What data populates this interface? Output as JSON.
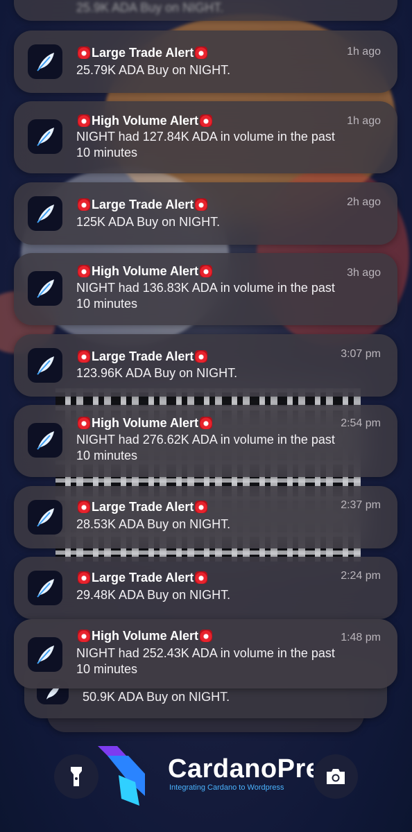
{
  "top_partial": {
    "text": "25.9K ADA Buy on NIGHT."
  },
  "notifications": [
    {
      "title": "Large Trade Alert",
      "time": "1h ago",
      "body": "25.79K ADA Buy on NIGHT."
    },
    {
      "title": "High Volume Alert",
      "time": "1h ago",
      "body": "NIGHT had 127.84K ADA in volume in the past\n10 minutes"
    },
    {
      "title": "Large Trade Alert",
      "time": "2h ago",
      "body": "125K ADA Buy on NIGHT."
    },
    {
      "title": "High Volume Alert",
      "time": "3h ago",
      "body": "NIGHT had 136.83K ADA in volume in the past\n10 minutes"
    },
    {
      "title": "Large Trade Alert",
      "time": "3:07 pm",
      "body": "123.96K ADA Buy on NIGHT."
    },
    {
      "title": "High Volume Alert",
      "time": "2:54 pm",
      "body": "NIGHT had 276.62K ADA in volume in the past\n10 minutes"
    },
    {
      "title": "Large Trade Alert",
      "time": "2:37 pm",
      "body": "28.53K ADA Buy on NIGHT."
    },
    {
      "title": "Large Trade Alert",
      "time": "2:24 pm",
      "body": "29.48K ADA Buy on NIGHT."
    },
    {
      "title": "High Volume Alert",
      "time": "1:48 pm",
      "body": "NIGHT had 252.43K ADA in volume in the past\n10 minutes"
    }
  ],
  "stacked_below": {
    "body": "50.9K ADA Buy on NIGHT."
  },
  "brand": {
    "name": "CardanoPress",
    "tagline": "Integrating Cardano to Wordpress"
  },
  "icons": {
    "app": "feather-icon",
    "alert": "siren-icon",
    "left_button": "flashlight-icon",
    "right_button": "camera-icon"
  }
}
